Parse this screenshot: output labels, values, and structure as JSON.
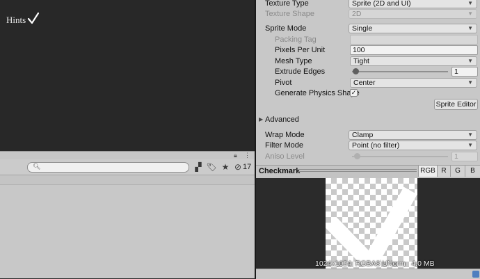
{
  "scene": {
    "hints_label": "Hints"
  },
  "project": {
    "search_placeholder": "",
    "hidden_count": "17"
  },
  "inspector": {
    "texture_type": {
      "label": "Texture Type",
      "value": "Sprite (2D and UI)"
    },
    "texture_shape": {
      "label": "Texture Shape",
      "value": "2D"
    },
    "sprite_mode": {
      "label": "Sprite Mode",
      "value": "Single"
    },
    "packing_tag": {
      "label": "Packing Tag",
      "value": ""
    },
    "pixels_per_unit": {
      "label": "Pixels Per Unit",
      "value": "100"
    },
    "mesh_type": {
      "label": "Mesh Type",
      "value": "Tight"
    },
    "extrude_edges": {
      "label": "Extrude Edges",
      "value": "1"
    },
    "pivot": {
      "label": "Pivot",
      "value": "Center"
    },
    "generate_physics_shape": {
      "label": "Generate Physics Shape",
      "checked": true
    },
    "sprite_editor_button": "Sprite Editor",
    "advanced_label": "Advanced",
    "wrap_mode": {
      "label": "Wrap Mode",
      "value": "Clamp"
    },
    "filter_mode": {
      "label": "Filter Mode",
      "value": "Point (no filter)"
    },
    "aniso_level": {
      "label": "Aniso Level",
      "value": "1"
    }
  },
  "preview": {
    "title": "Checkmark",
    "channels": [
      "RGB",
      "R",
      "G",
      "B"
    ],
    "active_channel": "RGB",
    "info": "1024x1024  RGBA8 UNorm   4.0 MB"
  }
}
